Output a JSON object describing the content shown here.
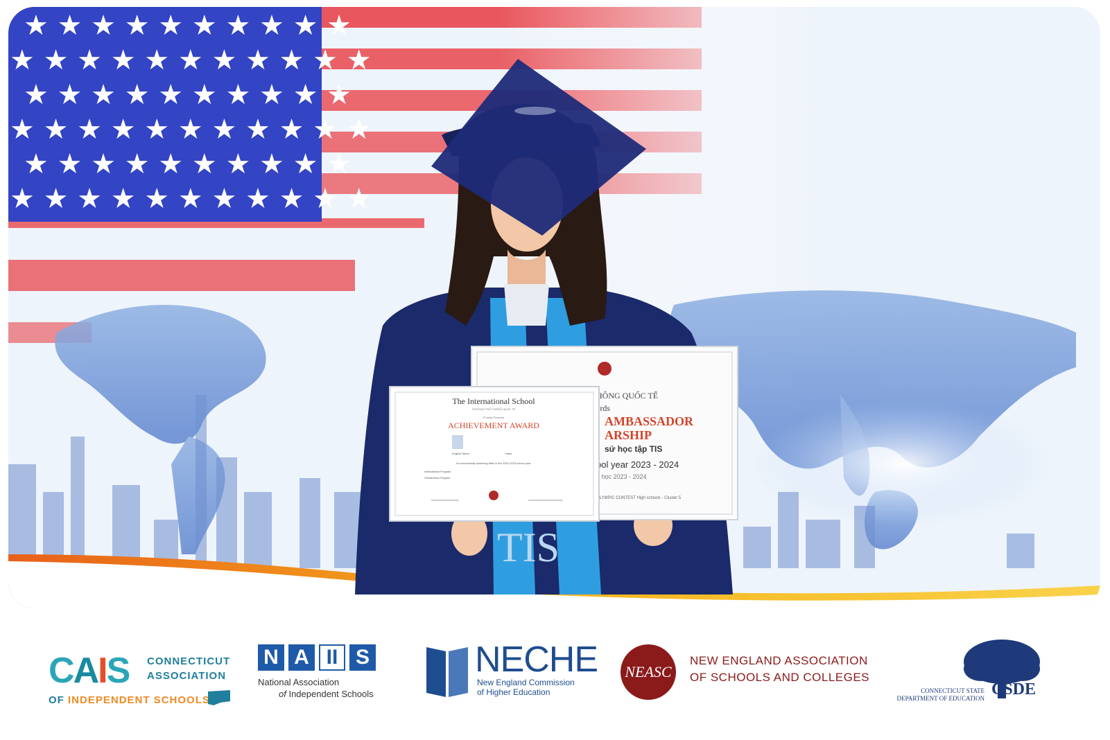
{
  "hero": {
    "certificate_front": {
      "school": "The International School",
      "school_vn": "TRƯỜNG PHỔ THÔNG QUỐC TẾ",
      "presents": "Proudly Presents",
      "award": "ACHIEVEMENT AWARD",
      "fields": [
        "English Name",
        "Class"
      ],
      "line": "for successfully achieving titles in the 2022-2023 school year",
      "programs": [
        "International Program",
        "Vietnamese Program"
      ]
    },
    "certificate_back": {
      "line1": "HÔNG QUỐC TẾ",
      "line2": "ards",
      "title1": "AMBASSADOR",
      "title2": "ARSHIP",
      "subtitle": "sứ học tập TIS",
      "year": "ool year 2023 - 2024",
      "year_vn": "h học 2023 - 2024",
      "contest": "OLYMPIC CONTEST High schools - Cluster 5"
    },
    "sash_text": "TIS"
  },
  "logos": {
    "cais": {
      "mark": [
        "C",
        "A",
        "I",
        "S"
      ],
      "side": [
        "CONNECTICUT",
        "ASSOCIATION"
      ],
      "bottom_of": "OF",
      "bottom_rest": "INDEPENDENT SCHOOLS"
    },
    "nais": {
      "letters": [
        "N",
        "A",
        "II",
        "S"
      ],
      "line1": "National Association",
      "line2_of": "of",
      "line2_rest": "Independent Schools"
    },
    "neche": {
      "title": "NECHE",
      "line1": "New England Commission",
      "line2": "of Higher Education"
    },
    "neasc": {
      "mark": "NEASC",
      "line1": "NEW ENGLAND ASSOCIATION",
      "line2": "OF SCHOOLS AND COLLEGES"
    },
    "csde": {
      "line1": "CONNECTICUT STATE",
      "line2": "DEPARTMENT OF EDUCATION",
      "abbr": "CSDE"
    }
  },
  "colors": {
    "flag_blue": "#3344c4",
    "flag_red": "#e8464c",
    "gown": "#1a2a6a",
    "sash": "#2f9ee0",
    "gold": "#f3b81c",
    "orange": "#e87a1a"
  }
}
